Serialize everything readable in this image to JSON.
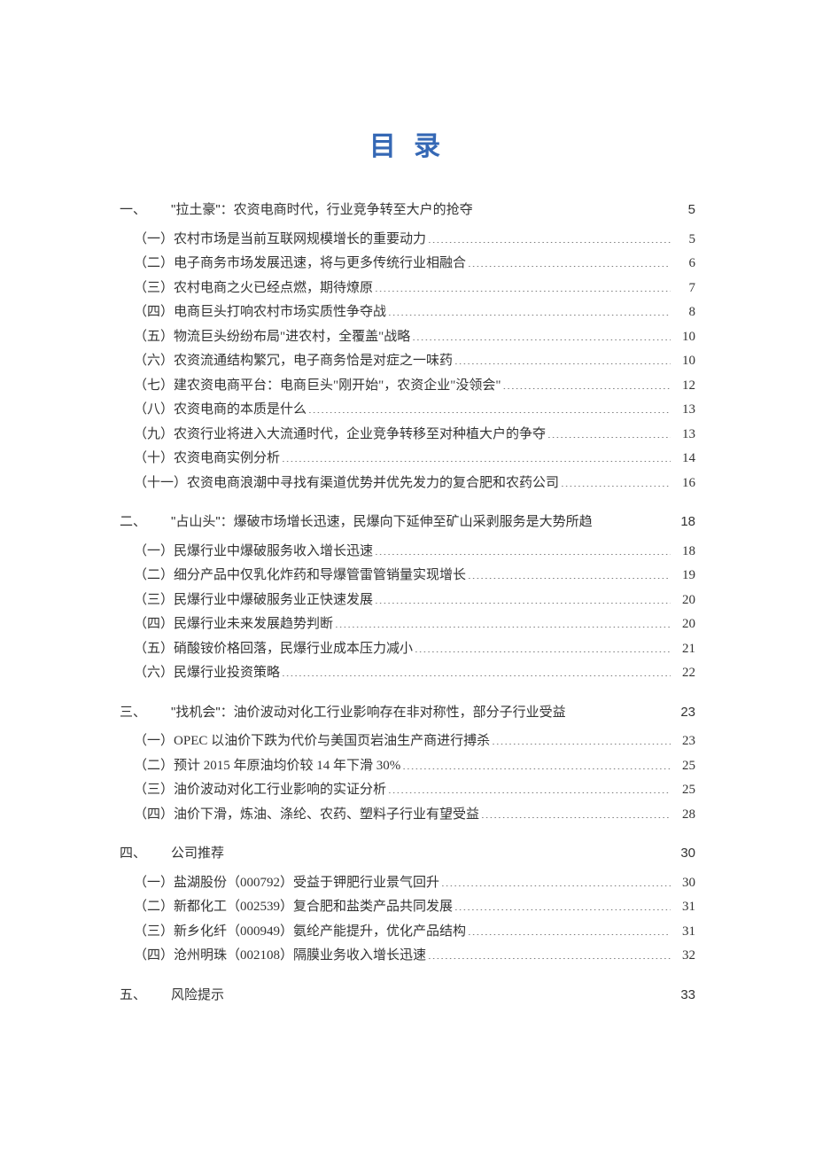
{
  "title": "目 录",
  "toc": [
    {
      "level": 1,
      "marker": "一、",
      "label": "\"拉土豪\"：农资电商时代，行业竞争转至大户的抢夺",
      "page": "5"
    },
    {
      "level": 2,
      "marker": "（一）",
      "label": "农村市场是当前互联网规模增长的重要动力",
      "page": "5"
    },
    {
      "level": 2,
      "marker": "（二）",
      "label": "电子商务市场发展迅速，将与更多传统行业相融合",
      "page": "6"
    },
    {
      "level": 2,
      "marker": "（三）",
      "label": "农村电商之火已经点燃，期待燎原",
      "page": "7"
    },
    {
      "level": 2,
      "marker": "（四）",
      "label": "电商巨头打响农村市场实质性争夺战",
      "page": "8"
    },
    {
      "level": 2,
      "marker": "（五）",
      "label": "物流巨头纷纷布局\"进农村，全覆盖\"战略",
      "page": "10"
    },
    {
      "level": 2,
      "marker": "（六）",
      "label": "农资流通结构繁冗，电子商务恰是对症之一味药",
      "page": "10"
    },
    {
      "level": 2,
      "marker": "（七）",
      "label": "建农资电商平台：电商巨头\"刚开始\"，农资企业\"没领会\"",
      "page": "12"
    },
    {
      "level": 2,
      "marker": "（八）",
      "label": "农资电商的本质是什么",
      "page": "13"
    },
    {
      "level": 2,
      "marker": "（九）",
      "label": "农资行业将进入大流通时代，企业竞争转移至对种植大户的争夺",
      "page": "13"
    },
    {
      "level": 2,
      "marker": "（十）",
      "label": "农资电商实例分析",
      "page": "14"
    },
    {
      "level": 2,
      "marker": "（十一）",
      "label": "农资电商浪潮中寻找有渠道优势并优先发力的复合肥和农药公司",
      "page": "16"
    },
    {
      "level": 1,
      "marker": "二、",
      "label": "\"占山头\"：爆破市场增长迅速，民爆向下延伸至矿山采剥服务是大势所趋",
      "page": "18"
    },
    {
      "level": 2,
      "marker": "（一）",
      "label": "民爆行业中爆破服务收入增长迅速",
      "page": "18"
    },
    {
      "level": 2,
      "marker": "（二）",
      "label": "细分产品中仅乳化炸药和导爆管雷管销量实现增长",
      "page": "19"
    },
    {
      "level": 2,
      "marker": "（三）",
      "label": "民爆行业中爆破服务业正快速发展",
      "page": "20"
    },
    {
      "level": 2,
      "marker": "（四）",
      "label": "民爆行业未来发展趋势判断",
      "page": "20"
    },
    {
      "level": 2,
      "marker": "（五）",
      "label": "硝酸铵价格回落，民爆行业成本压力减小",
      "page": "21"
    },
    {
      "level": 2,
      "marker": "（六）",
      "label": "民爆行业投资策略",
      "page": "22"
    },
    {
      "level": 1,
      "marker": "三、",
      "label": "\"找机会\"：油价波动对化工行业影响存在非对称性，部分子行业受益",
      "page": "23"
    },
    {
      "level": 2,
      "marker": "（一）",
      "label": "OPEC 以油价下跌为代价与美国页岩油生产商进行搏杀",
      "page": "23"
    },
    {
      "level": 2,
      "marker": "（二）",
      "label": "预计 2015 年原油均价较 14 年下滑 30%",
      "page": "25"
    },
    {
      "level": 2,
      "marker": "（三）",
      "label": "油价波动对化工行业影响的实证分析",
      "page": "25"
    },
    {
      "level": 2,
      "marker": "（四）",
      "label": "油价下滑，炼油、涤纶、农药、塑料子行业有望受益",
      "page": "28"
    },
    {
      "level": 1,
      "marker": "四、",
      "label": "公司推荐",
      "page": "30"
    },
    {
      "level": 2,
      "marker": "（一）",
      "label": "盐湖股份（000792）受益于钾肥行业景气回升",
      "page": "30"
    },
    {
      "level": 2,
      "marker": "（二）",
      "label": "新都化工（002539）复合肥和盐类产品共同发展",
      "page": "31"
    },
    {
      "level": 2,
      "marker": "（三）",
      "label": "新乡化纤（000949）氨纶产能提升，优化产品结构",
      "page": "31"
    },
    {
      "level": 2,
      "marker": "（四）",
      "label": "沧州明珠（002108）隔膜业务收入增长迅速",
      "page": "32"
    },
    {
      "level": 1,
      "marker": "五、",
      "label": "风险提示",
      "page": "33"
    }
  ]
}
